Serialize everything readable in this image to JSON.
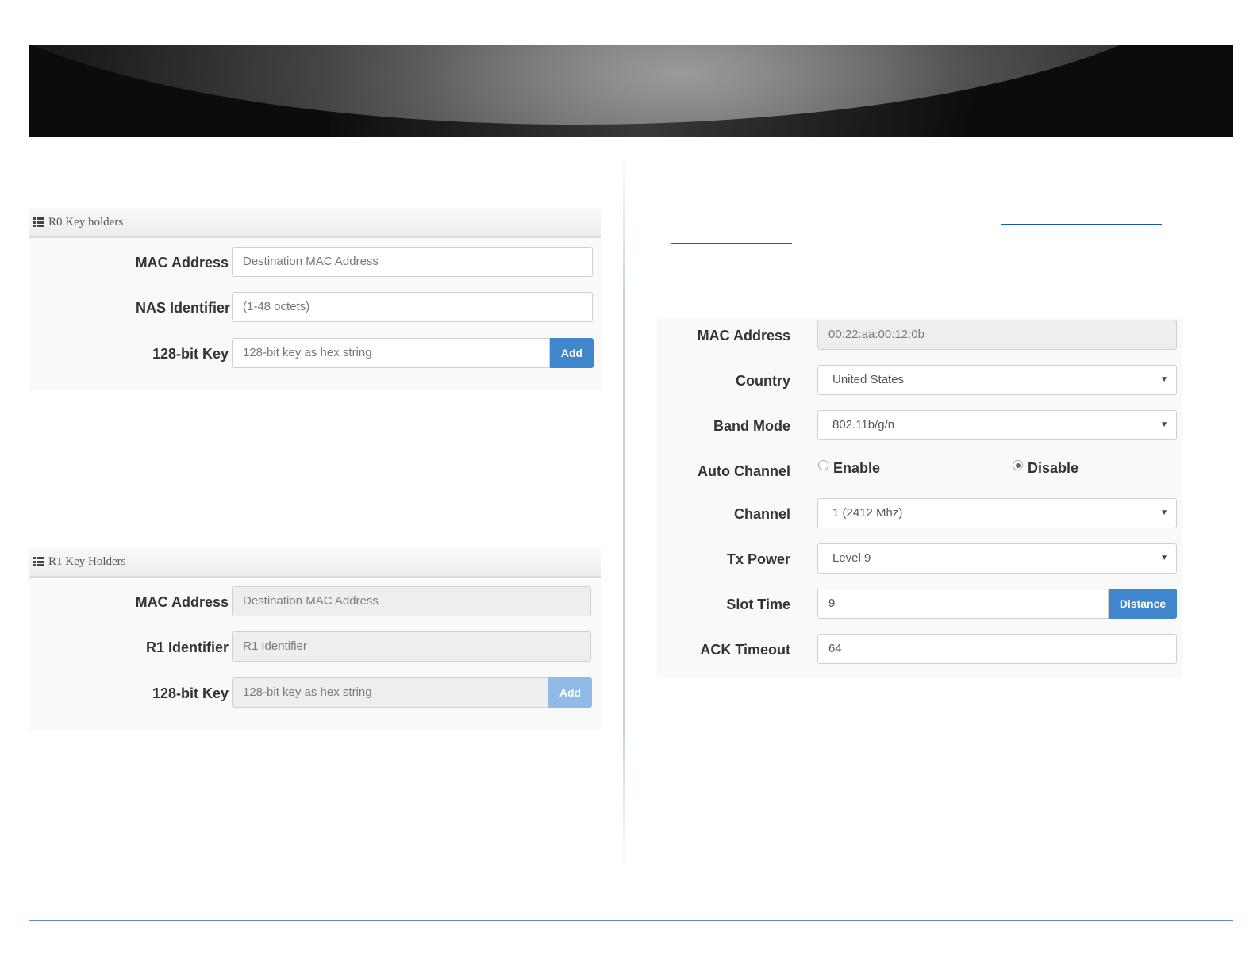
{
  "r0_panel": {
    "title": "R0 Key holders",
    "mac_label": "MAC Address",
    "mac_placeholder": "Destination MAC Address",
    "nas_label": "NAS Identifier",
    "nas_placeholder": "(1-48 octets)",
    "key_label": "128-bit Key",
    "key_placeholder": "128-bit key as hex string",
    "add_label": "Add"
  },
  "r1_panel": {
    "title": "R1 Key Holders",
    "mac_label": "MAC Address",
    "mac_placeholder": "Destination MAC Address",
    "r1_label": "R1 Identifier",
    "r1_placeholder": "R1 Identifier",
    "key_label": "128-bit Key",
    "key_placeholder": "128-bit key as hex string",
    "add_label": "Add"
  },
  "radio_panel": {
    "mac_label": "MAC Address",
    "mac_value": "00:22:aa:00:12:0b",
    "country_label": "Country",
    "country_value": "United States",
    "band_label": "Band Mode",
    "band_value": "802.11b/g/n",
    "auto_channel_label": "Auto Channel",
    "enable_label": "Enable",
    "disable_label": "Disable",
    "auto_channel_selected": "Disable",
    "channel_label": "Channel",
    "channel_value": "1 (2412 Mhz)",
    "tx_label": "Tx Power",
    "tx_value": "Level 9",
    "slot_label": "Slot Time",
    "slot_value": "9",
    "distance_label": "Distance",
    "ack_label": "ACK Timeout",
    "ack_value": "64"
  },
  "icons": {
    "panel_icon": "list-icon",
    "select_icon": "caret-down-icon",
    "radio_icon": "radio-icon"
  },
  "colors": {
    "button_blue": "#3f86cd",
    "button_blue_disabled": "#8fbbe5",
    "footer_line": "#5b8fd0",
    "link": "#1a55b8"
  }
}
